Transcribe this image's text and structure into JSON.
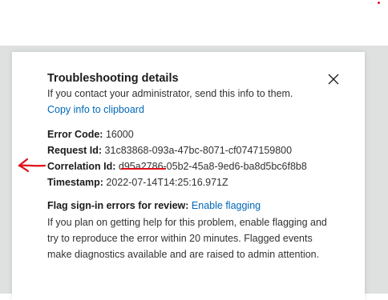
{
  "dialog": {
    "title": "Troubleshooting details",
    "intro": "If you contact your administrator, send this info to them.",
    "copy_link": "Copy info to clipboard"
  },
  "details": [
    {
      "label": "Error Code:",
      "value": "16000"
    },
    {
      "label": "Request Id:",
      "value": "31c83868-093a-47bc-8071-cf0747159800"
    },
    {
      "label": "Correlation Id:",
      "value": "d95a2786-05b2-45a8-9ed6-ba8d5bc6f8b8"
    },
    {
      "label": "Timestamp:",
      "value": "2022-07-14T14:25:16.971Z"
    }
  ],
  "flagging": {
    "label": "Flag sign-in errors for review:",
    "link": "Enable flagging",
    "description": "If you plan on getting help for this problem, enable flagging and try to reproduce the error within 20 minutes. Flagged events make diagnostics available and are raised to admin attention."
  },
  "annotation_color": "#e0101b",
  "icons": {
    "close": "close-icon",
    "annotation": "red-arrow-annotation"
  }
}
